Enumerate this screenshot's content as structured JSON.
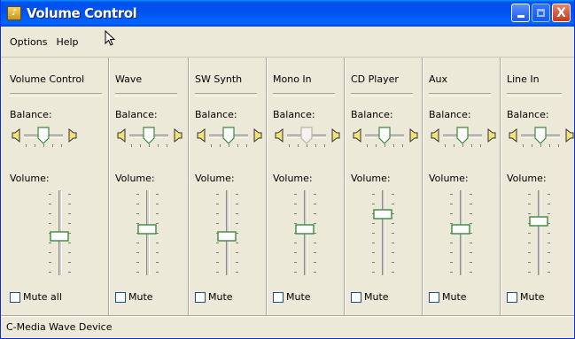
{
  "window": {
    "title": "Volume Control",
    "buttons": {
      "minimize": "minimize",
      "maximize": "maximize",
      "close": "X"
    }
  },
  "menu": [
    "Options",
    "Help"
  ],
  "labels": {
    "balance": "Balance:",
    "volume": "Volume:"
  },
  "columns": [
    {
      "title": "Volume Control",
      "mute_label": "Mute all",
      "balance": 0.5,
      "volume": 0.45,
      "balance_enabled": true
    },
    {
      "title": "Wave",
      "mute_label": "Mute",
      "balance": 0.5,
      "volume": 0.55,
      "balance_enabled": true
    },
    {
      "title": "SW Synth",
      "mute_label": "Mute",
      "balance": 0.5,
      "volume": 0.45,
      "balance_enabled": true
    },
    {
      "title": "Mono In",
      "mute_label": "Mute",
      "balance": 0.5,
      "volume": 0.55,
      "balance_enabled": false
    },
    {
      "title": "CD Player",
      "mute_label": "Mute",
      "balance": 0.5,
      "volume": 0.75,
      "balance_enabled": true
    },
    {
      "title": "Aux",
      "mute_label": "Mute",
      "balance": 0.5,
      "volume": 0.55,
      "balance_enabled": true
    },
    {
      "title": "Line In",
      "mute_label": "Mute",
      "balance": 0.5,
      "volume": 0.65,
      "balance_enabled": true
    }
  ],
  "status": "C-Media Wave Device",
  "colors": {
    "title_bar": "#0050ee",
    "window_bg": "#ece9d8",
    "slider_thumb_border": "#3a8a3a",
    "close_button": "#c3391b"
  },
  "icons": {
    "app": "speaker-app-icon",
    "speaker_left": "speaker-left-icon",
    "speaker_right": "speaker-right-icon",
    "cursor": "mouse-pointer-icon"
  }
}
